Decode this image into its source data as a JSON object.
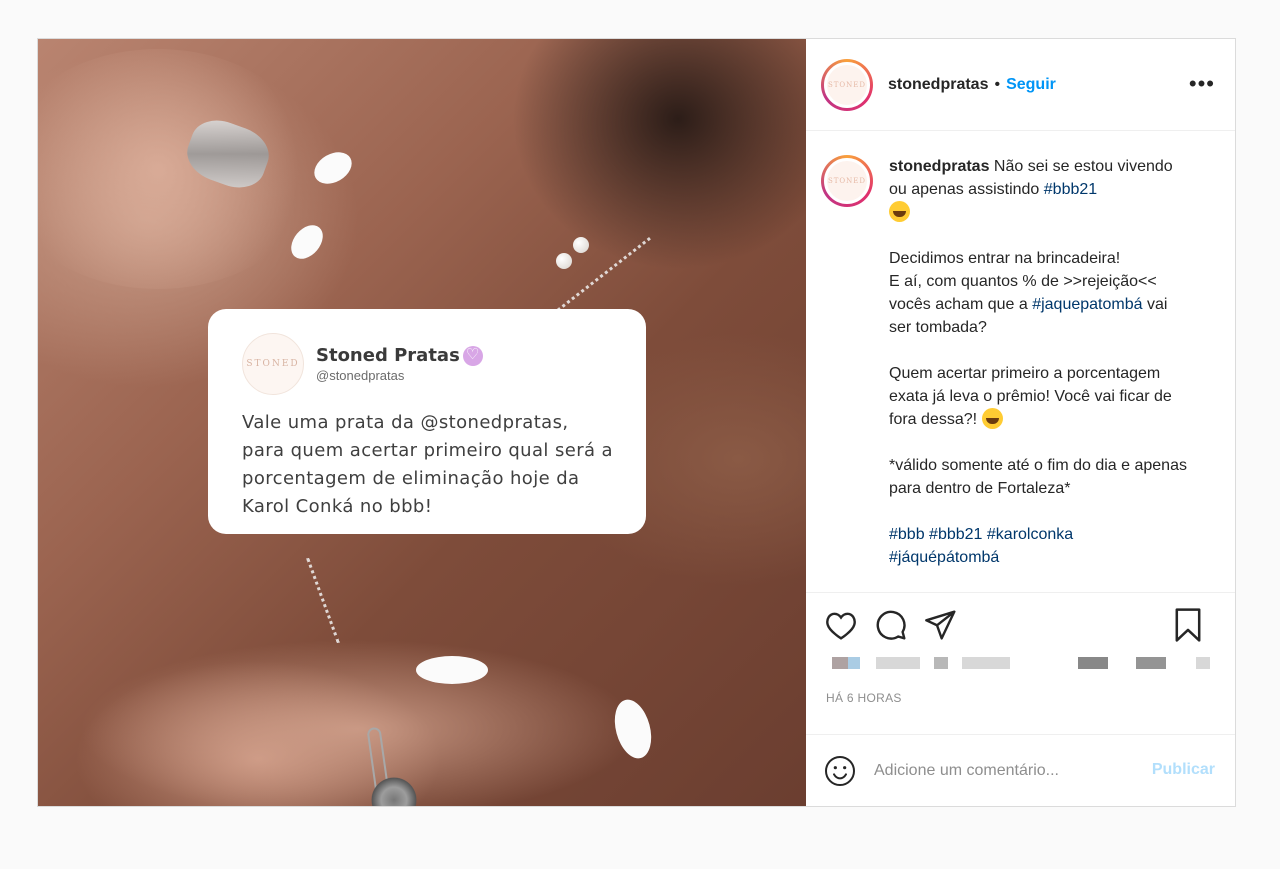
{
  "post": {
    "username": "stonedpratas",
    "follow_label": "Seguir",
    "separator": "•",
    "more_icon": "more-horizontal-icon",
    "avatar_text": "STONED"
  },
  "tweet": {
    "name": "Stoned Pratas",
    "handle": "@stonedpratas",
    "avatar_text": "STONED",
    "text": "Vale uma prata da @stonedpratas, para quem acertar primeiro qual será a porcentagem de eliminação hoje da Karol Conká no bbb!"
  },
  "caption": {
    "username": "stonedpratas",
    "line1_text": " Não sei se estou vivendo ou apenas assistindo ",
    "line1_tag": "#bbb21",
    "p2": "Decidimos entrar na brincadeira!",
    "p3": "E aí, com quantos % de >>rejeição<< vocês acham que a ",
    "p3_tag": "#jaquepatombá",
    "p3_end": " vai ser tombada?",
    "p4": "Quem acertar primeiro a porcentagem exata já leva o prêmio! Você vai ficar de fora dessa?! ",
    "p5": "*válido somente até o fim do dia e apenas para dentro de Fortaleza*",
    "tags": [
      "#bbb",
      "#bbb21",
      "#karolconka"
    ],
    "tag_last": "#jáquépátombá"
  },
  "actions": {
    "like_icon": "heart-icon",
    "comment_icon": "comment-icon",
    "share_icon": "send-icon",
    "save_icon": "bookmark-icon"
  },
  "timestamp": "HÁ 6 HORAS",
  "comment": {
    "placeholder": "Adicione um comentário...",
    "publish_label": "Publicar",
    "emoji_icon": "smiley-icon"
  },
  "colors": {
    "follow": "#0095f6",
    "hashtag": "#00376b",
    "publish_disabled": "#b2dffc",
    "muted": "#8e8e8e"
  }
}
